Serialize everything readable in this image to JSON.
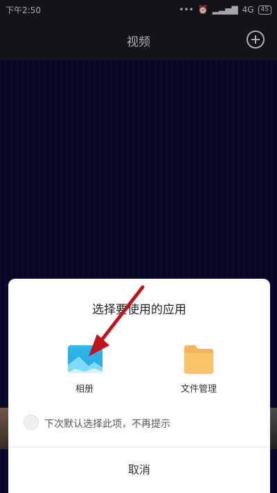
{
  "status": {
    "time": "下午2:50",
    "signal": "4G",
    "battery": "45"
  },
  "header": {
    "title": "视频"
  },
  "sheet": {
    "title": "选择要使用的应用",
    "apps": [
      {
        "label": "相册",
        "icon": "photo-album-icon"
      },
      {
        "label": "文件管理",
        "icon": "folder-icon"
      }
    ],
    "remember_label": "下次默认选择此项，不再提示",
    "cancel_label": "取消"
  },
  "colors": {
    "arrow": "#c0141c",
    "album": "#2fb8e8",
    "folder": "#f6b65a"
  }
}
